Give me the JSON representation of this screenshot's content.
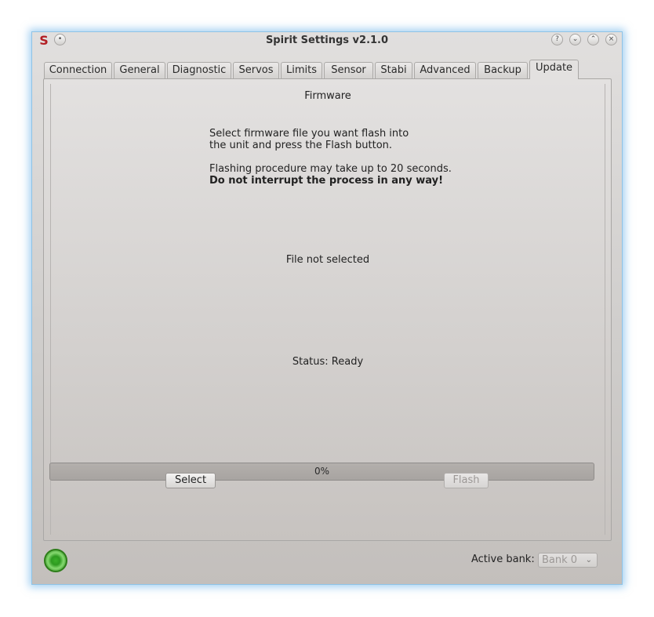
{
  "window": {
    "title": "Spirit Settings v2.1.0",
    "app_icon_glyph": "S",
    "title_buttons": [
      "?",
      "⌄",
      "⌃",
      "×"
    ],
    "menu_button_glyph": "•"
  },
  "tabs": [
    {
      "label": "Connection"
    },
    {
      "label": "General"
    },
    {
      "label": "Diagnostic"
    },
    {
      "label": "Servos"
    },
    {
      "label": "Limits"
    },
    {
      "label": "Sensor"
    },
    {
      "label": "Stabi"
    },
    {
      "label": "Advanced"
    },
    {
      "label": "Backup"
    },
    {
      "label": "Update",
      "active": true
    }
  ],
  "firmware": {
    "group_title": "Firmware",
    "instructions": [
      "Select firmware file you want flash into",
      "the unit and press the Flash button."
    ],
    "warning_line": "Flashing procedure may take up to 20 seconds.",
    "warning_bold": "Do not interrupt the process in any way!",
    "file_status": "File not selected",
    "status": "Status: Ready",
    "progress_text": "0%",
    "progress_value": 0,
    "select_button": "Select",
    "flash_button": "Flash"
  },
  "footer": {
    "active_bank_label": "Active bank:",
    "active_bank_value": "Bank 0",
    "connection_led_color": "#2e9a20"
  }
}
